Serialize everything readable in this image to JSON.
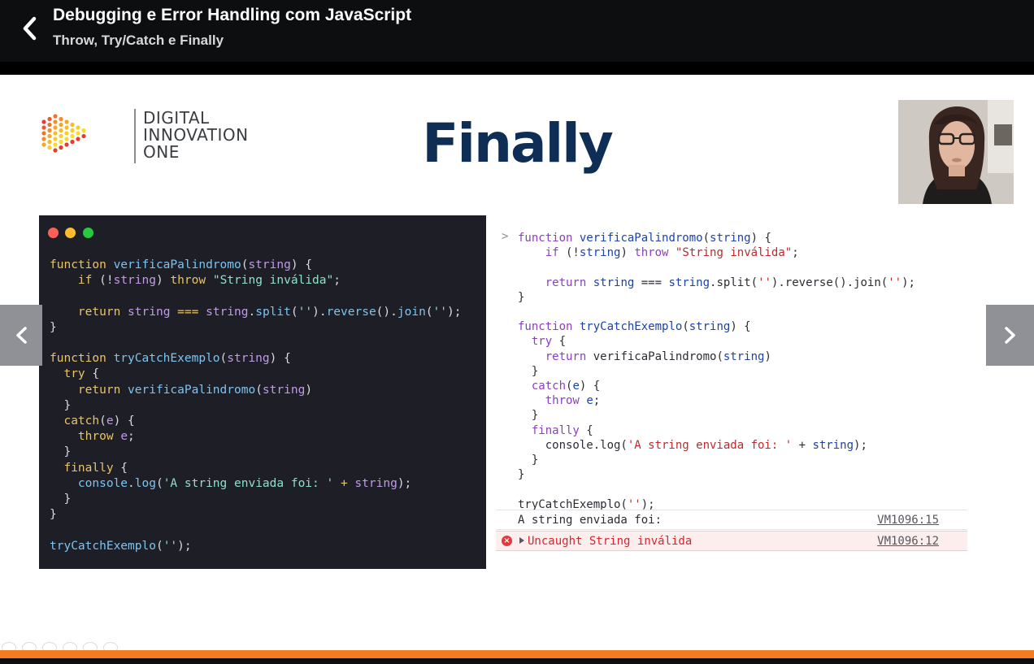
{
  "header": {
    "title": "Debugging e Error Handling com JavaScript",
    "subtitle": "Throw, Try/Catch e Finally"
  },
  "slide": {
    "title": "Finally",
    "logo": {
      "line1": "DIGITAL",
      "line2": "INNOVATION",
      "line3": "ONE"
    }
  },
  "colors": {
    "accent_orange": "#f47c20",
    "title_navy": "#0e2e56",
    "editor_bg": "#1e1f26"
  },
  "editor": {
    "window_dots": [
      "close",
      "minimize",
      "maximize"
    ]
  },
  "console": {
    "prompt": ">",
    "log_message": "A string enviada foi:",
    "log_source": "VM1096:15",
    "error_message": "Uncaught String inválida",
    "error_source": "VM1096:12",
    "error_icon": "error-circle-icon"
  },
  "navigation": {
    "back_icon": "chevron-left-icon",
    "prev_icon": "chevron-left-icon",
    "next_icon": "chevron-right-icon"
  }
}
